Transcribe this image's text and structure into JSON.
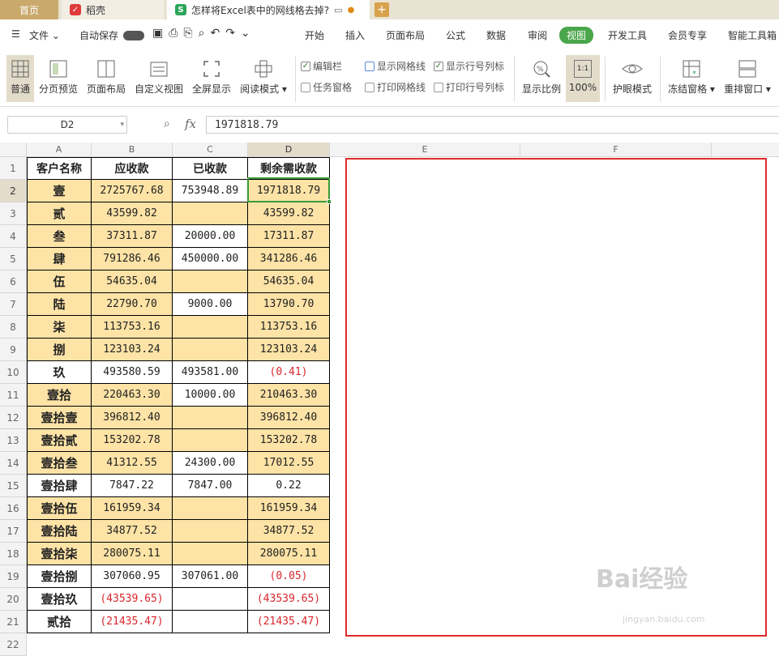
{
  "tabs": {
    "home": "首页",
    "daoke": "稻壳",
    "doc": "怎样将Excel表中的网线格去掉?"
  },
  "menu": {
    "file": "文件",
    "autosave": "自动保存",
    "items": [
      "开始",
      "插入",
      "页面布局",
      "公式",
      "数据",
      "审阅",
      "视图",
      "开发工具",
      "会员专享",
      "智能工具箱"
    ]
  },
  "ribbon": {
    "buttons": [
      "普通",
      "分页预览",
      "页面布局",
      "自定义视图",
      "全屏显示",
      "阅读模式"
    ],
    "checks": [
      {
        "label": "编辑栏",
        "checked": true
      },
      {
        "label": "显示网格线",
        "checked": false
      },
      {
        "label": "显示行号列标",
        "checked": true
      },
      {
        "label": "任务窗格",
        "checked": false
      },
      {
        "label": "打印网格线",
        "checked": false
      },
      {
        "label": "打印行号列标",
        "checked": false
      }
    ],
    "zoom_label": "显示比例",
    "zoom_value": "100%",
    "zoom_icon": "1:1",
    "eye_mode": "护眼模式",
    "freeze": "冻结窗格",
    "rearrange": "重排窗口"
  },
  "formula": {
    "namebox": "D2",
    "fx": "fx",
    "value": "1971818.79"
  },
  "columns": [
    "A",
    "B",
    "C",
    "D",
    "E",
    "F"
  ],
  "headers": [
    "客户名称",
    "应收款",
    "已收款",
    "剩余需收款"
  ],
  "rows": [
    {
      "n": "1"
    },
    {
      "n": "2",
      "name": "壹",
      "b": "2725767.68",
      "c": "753948.89",
      "d": "1971818.79",
      "fill": true
    },
    {
      "n": "3",
      "name": "贰",
      "b": "43599.82",
      "c": "",
      "d": "43599.82",
      "fill": true
    },
    {
      "n": "4",
      "name": "叁",
      "b": "37311.87",
      "c": "20000.00",
      "d": "17311.87",
      "fill": true
    },
    {
      "n": "5",
      "name": "肆",
      "b": "791286.46",
      "c": "450000.00",
      "d": "341286.46",
      "fill": true
    },
    {
      "n": "6",
      "name": "伍",
      "b": "54635.04",
      "c": "",
      "d": "54635.04",
      "fill": true
    },
    {
      "n": "7",
      "name": "陆",
      "b": "22790.70",
      "c": "9000.00",
      "d": "13790.70",
      "fill": true
    },
    {
      "n": "8",
      "name": "柒",
      "b": "113753.16",
      "c": "",
      "d": "113753.16",
      "fill": true
    },
    {
      "n": "9",
      "name": "捌",
      "b": "123103.24",
      "c": "",
      "d": "123103.24",
      "fill": true
    },
    {
      "n": "10",
      "name": "玖",
      "b": "493580.59",
      "c": "493581.00",
      "d": "(0.41)",
      "fill": false,
      "neg_d": true
    },
    {
      "n": "11",
      "name": "壹拾",
      "b": "220463.30",
      "c": "10000.00",
      "d": "210463.30",
      "fill": true
    },
    {
      "n": "12",
      "name": "壹拾壹",
      "b": "396812.40",
      "c": "",
      "d": "396812.40",
      "fill": true
    },
    {
      "n": "13",
      "name": "壹拾贰",
      "b": "153202.78",
      "c": "",
      "d": "153202.78",
      "fill": true
    },
    {
      "n": "14",
      "name": "壹拾叁",
      "b": "41312.55",
      "c": "24300.00",
      "d": "17012.55",
      "fill": true
    },
    {
      "n": "15",
      "name": "壹拾肆",
      "b": "7847.22",
      "c": "7847.00",
      "d": "0.22",
      "fill": false
    },
    {
      "n": "16",
      "name": "壹拾伍",
      "b": "161959.34",
      "c": "",
      "d": "161959.34",
      "fill": true
    },
    {
      "n": "17",
      "name": "壹拾陆",
      "b": "34877.52",
      "c": "",
      "d": "34877.52",
      "fill": true
    },
    {
      "n": "18",
      "name": "壹拾柒",
      "b": "280075.11",
      "c": "",
      "d": "280075.11",
      "fill": true
    },
    {
      "n": "19",
      "name": "壹拾捌",
      "b": "307060.95",
      "c": "307061.00",
      "d": "(0.05)",
      "fill": false,
      "neg_d": true
    },
    {
      "n": "20",
      "name": "壹拾玖",
      "b": "(43539.65)",
      "c": "",
      "d": "(43539.65)",
      "fill": false,
      "neg_b": true,
      "neg_d": true
    },
    {
      "n": "21",
      "name": "贰拾",
      "b": "(21435.47)",
      "c": "",
      "d": "(21435.47)",
      "fill": false,
      "neg_b": true,
      "neg_d": true
    },
    {
      "n": "22"
    }
  ],
  "colors": {
    "fill": "#fde3a6",
    "accent": "#4aa64a",
    "selection": "#3a9a3a",
    "highlight_box": "#e02b2b"
  },
  "watermark": {
    "text": "Bai经验",
    "url": "jingyan.baidu.com"
  }
}
